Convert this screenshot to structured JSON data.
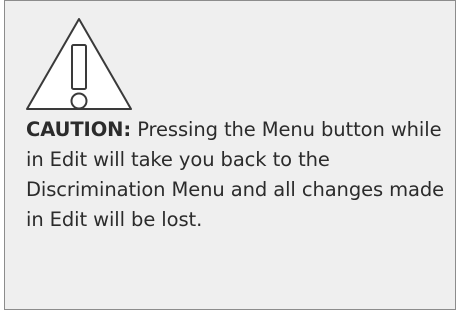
{
  "notice": {
    "label": "CAUTION:",
    "message": " Pressing the Menu button while in Edit will take you back to the Discrimination Menu and all changes made in Edit will be lost.",
    "icon": "warning-triangle-icon"
  },
  "colors": {
    "background": "#efefef",
    "border": "#8c8c8c",
    "text": "#2b2b2b",
    "icon_stroke": "#3a3a3a"
  }
}
